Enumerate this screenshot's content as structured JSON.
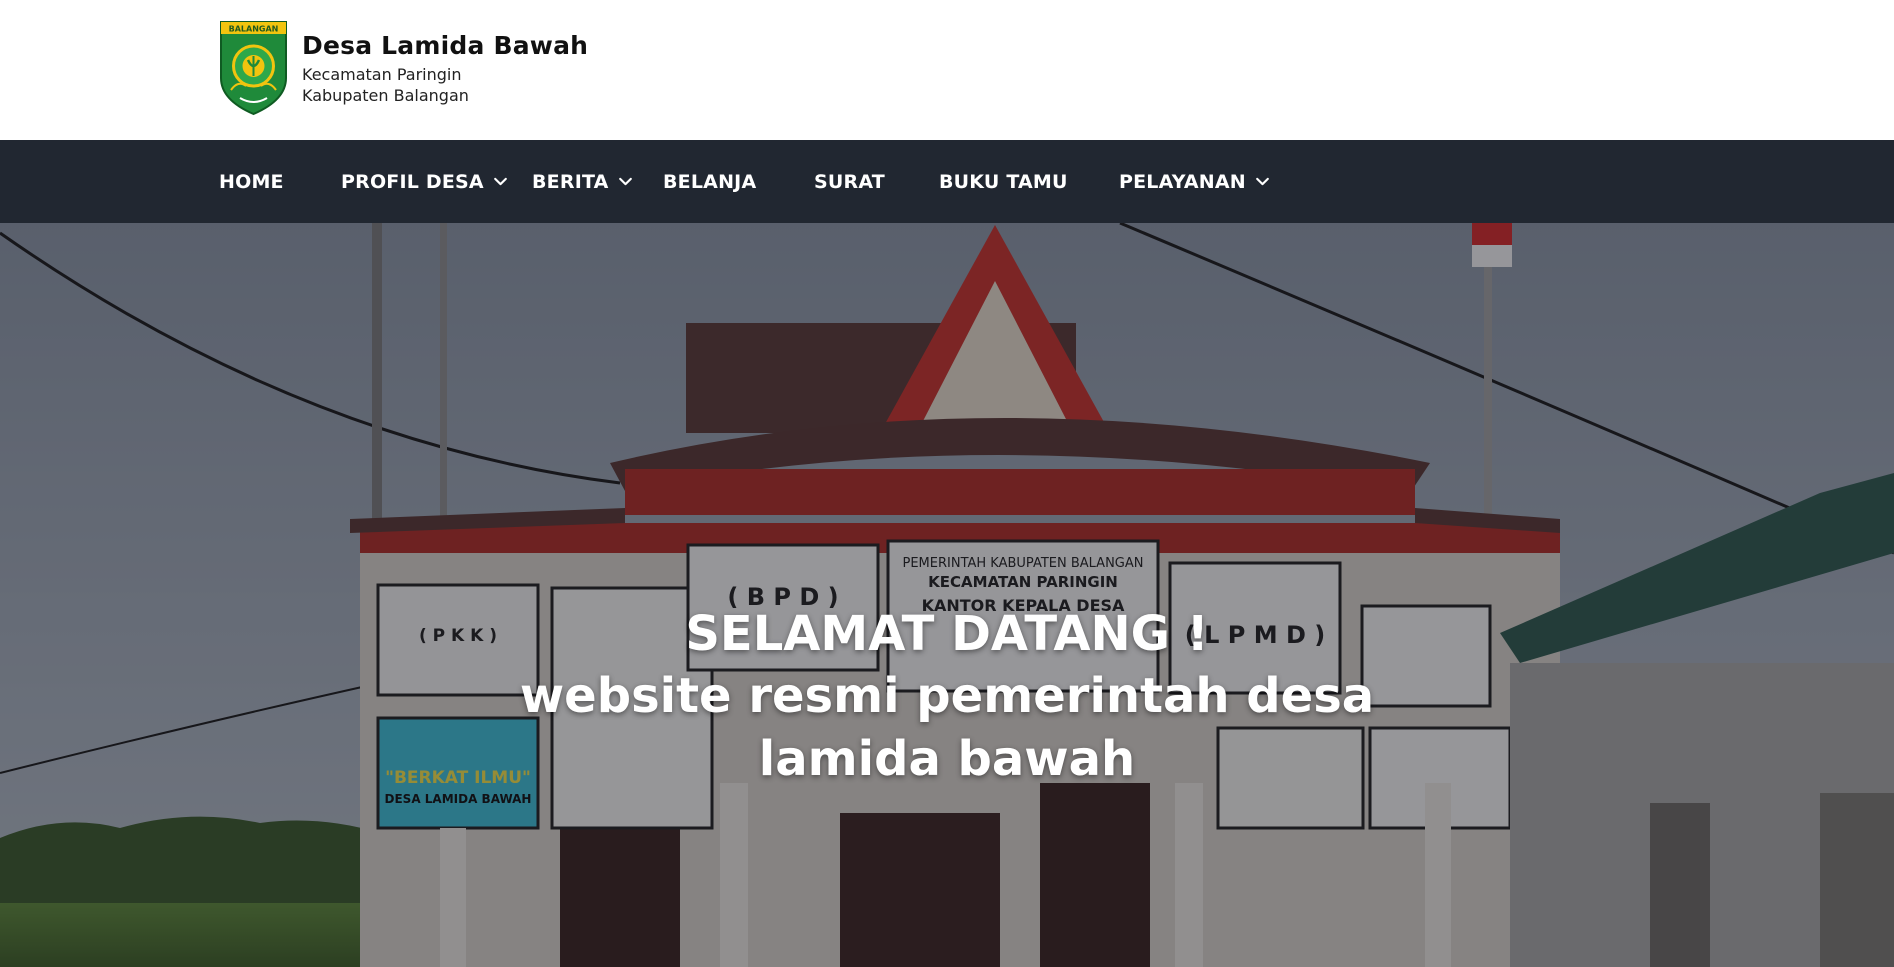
{
  "site": {
    "name": "Desa Lamida Bawah",
    "subtitle_1": "Kecamatan Paringin",
    "subtitle_2": "Kabupaten Balangan",
    "logo_text": "BALANGAN"
  },
  "nav": {
    "items": [
      {
        "label": "HOME",
        "dropdown": false
      },
      {
        "label": "PROFIL DESA",
        "dropdown": true
      },
      {
        "label": "BERITA",
        "dropdown": true
      },
      {
        "label": "BELANJA",
        "dropdown": false
      },
      {
        "label": "SURAT",
        "dropdown": false
      },
      {
        "label": "BUKU TAMU",
        "dropdown": false
      },
      {
        "label": "PELAYANAN",
        "dropdown": true
      }
    ]
  },
  "hero": {
    "heading": "SELAMAT DATANG !",
    "subheading": "website resmi pemerintah desa lamida bawah",
    "sign_texts": [
      "PEMERINTAH KABUPATEN BALANGAN",
      "KECAMATAN PARINGIN",
      "KANTOR KEPALA DESA",
      "( B P D )",
      "( L P M D )",
      "( P K K )",
      "\"BERKAT ILMU\"",
      "DESA LAMIDA BAWAH"
    ]
  },
  "colors": {
    "nav_bg": "#212731",
    "header_bg": "#ffffff",
    "text_dark": "#111111",
    "hero_text": "#ffffff"
  }
}
